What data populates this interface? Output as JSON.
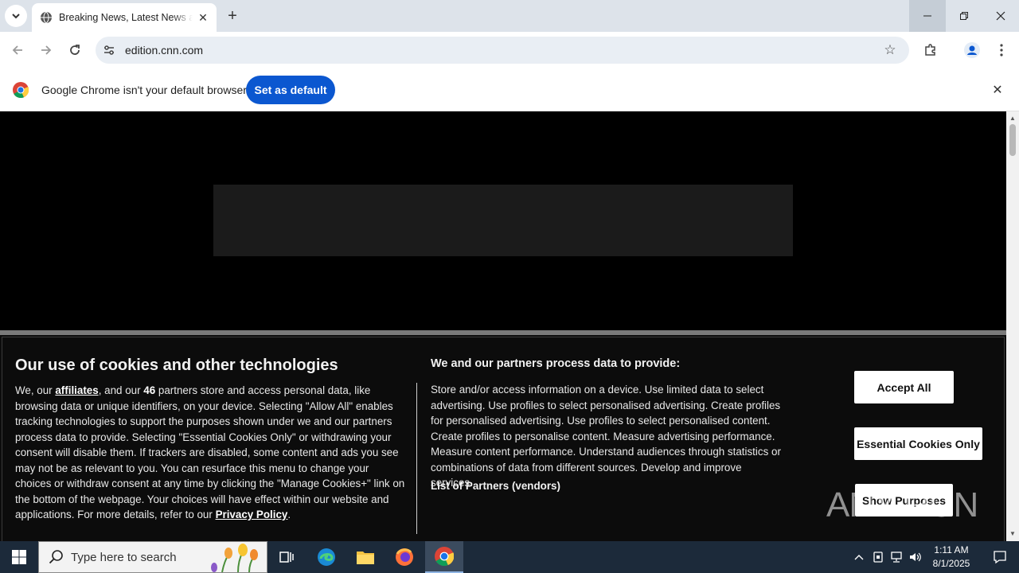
{
  "browser": {
    "tab": {
      "title": "Breaking News, Latest News and Videos | CNN"
    },
    "url": "edition.cnn.com",
    "infobar": {
      "text": "Google Chrome isn't your default browser",
      "button": "Set as default"
    }
  },
  "cookie_banner": {
    "title": "Our use of cookies and other technologies",
    "left_text": {
      "intro": "We, our ",
      "affiliates_link": "affiliates",
      "and_our": ", and our ",
      "partner_count": "46",
      "body": " partners store and access personal data, like browsing data or unique identifiers, on your device. Selecting \"Allow All\" enables tracking technologies to support the purposes shown under we and our partners process data to provide. Selecting \"Essential Cookies Only\" or withdrawing your consent will disable them. If trackers are disabled, some content and ads you see may not be as relevant to you. You can resurface this menu to change your choices or withdraw consent at any time by clicking the \"Manage Cookies+\" link on the bottom of the webpage. Your choices will have effect within our website and applications. For more details, refer to our ",
      "privacy_link": "Privacy Policy",
      "end": "."
    },
    "mid_heading": "We and our partners process data to provide:",
    "mid_text": "Store and/or access information on a device. Use limited data to select advertising. Use profiles to select personalised advertising. Create profiles for personalised advertising. Use profiles to select personalised content. Create profiles to personalise content. Measure advertising performance. Measure content performance. Understand audiences through statistics or combinations of data from different sources. Develop and improve services.",
    "partners_link": "List of Partners (vendors)",
    "buttons": {
      "accept": "Accept All",
      "essential": "Essential Cookies Only",
      "purposes": "Show Purposes"
    }
  },
  "watermark": {
    "text": "ANY RUN"
  },
  "taskbar": {
    "search_placeholder": "Type here to search",
    "clock_time": "1:11 AM",
    "clock_date": "8/1/2025"
  }
}
